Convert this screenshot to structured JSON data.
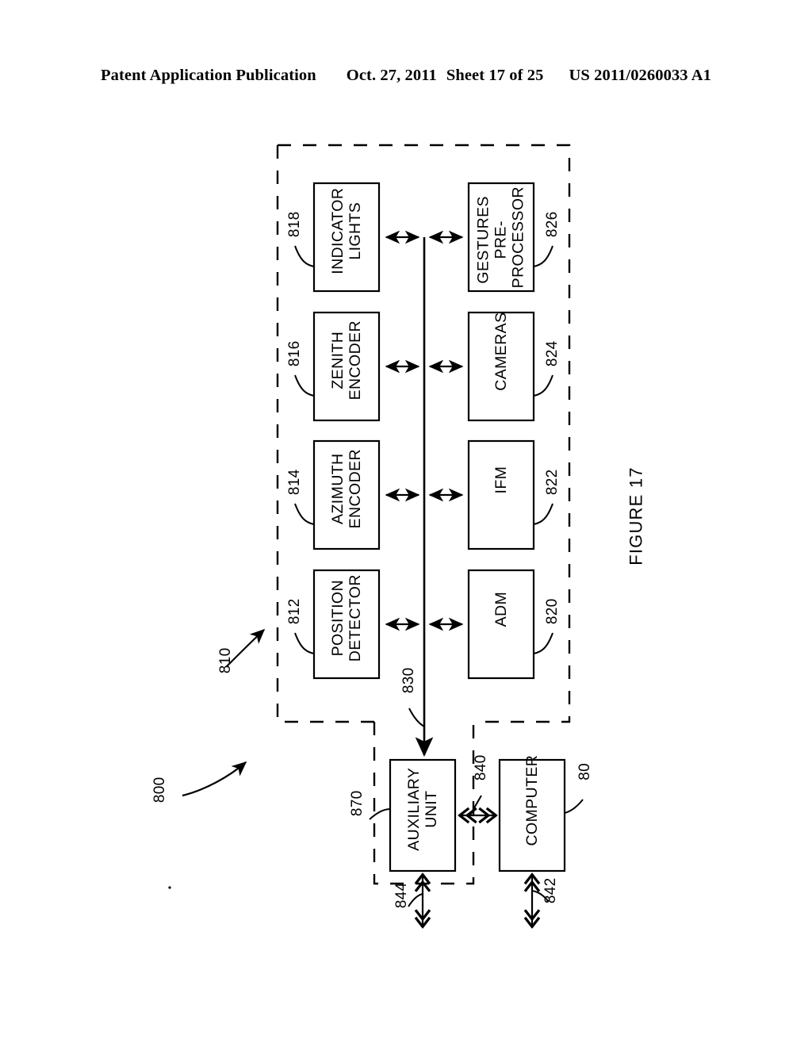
{
  "header": {
    "publication": "Patent Application Publication",
    "date": "Oct. 27, 2011",
    "sheet": "Sheet 17 of 25",
    "pub_number": "US 2011/0260033 A1"
  },
  "figure": {
    "label": "FIGURE 17",
    "system_ref": "800",
    "tracker_ref": "810",
    "bus_ref": "830"
  },
  "boxes": {
    "indicator_lights": {
      "label": "INDICATOR\nLIGHTS",
      "ref": "818"
    },
    "zenith_encoder": {
      "label": "ZENITH\nENCODER",
      "ref": "816"
    },
    "azimuth_encoder": {
      "label": "AZIMUTH\nENCODER",
      "ref": "814"
    },
    "position_detector": {
      "label": "POSITION\nDETECTOR",
      "ref": "812"
    },
    "gestures_preprocessor": {
      "label": "GESTURES\nPRE-\nPROCESSOR",
      "ref": "826"
    },
    "cameras": {
      "label": "CAMERAS",
      "ref": "824"
    },
    "ifm": {
      "label": "IFM",
      "ref": "822"
    },
    "adm": {
      "label": "ADM",
      "ref": "820"
    },
    "auxiliary_unit": {
      "label": "AUXILIARY\nUNIT",
      "ref": "870"
    },
    "computer": {
      "label": "COMPUTER",
      "ref": "80"
    }
  },
  "connectors": {
    "aux_to_computer_ref": "840",
    "aux_external_ref": "844",
    "computer_external_ref": "842"
  },
  "colors": {
    "ink": "#000000",
    "paper": "#ffffff"
  }
}
